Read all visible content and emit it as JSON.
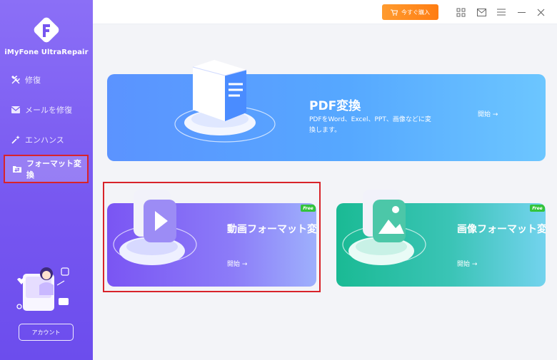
{
  "app": {
    "name": "iMyFone UltraRepair"
  },
  "sidebar": {
    "items": [
      {
        "label": "修復",
        "icon": "tools-icon"
      },
      {
        "label": "メールを修復",
        "icon": "mail-icon"
      },
      {
        "label": "エンハンス",
        "icon": "magic-wand-icon"
      },
      {
        "label": "フォーマット変換",
        "icon": "folder-convert-icon",
        "active": true
      }
    ],
    "account_label": "アカウント"
  },
  "topbar": {
    "buy_label": "今すぐ購入",
    "icons": [
      "apps-grid-icon",
      "mail-icon",
      "menu-icon",
      "minimize-icon",
      "close-icon"
    ]
  },
  "cards": {
    "pdf": {
      "title": "PDF変換",
      "desc_line1": "PDFをWord、Excel、PPT、画像などに変",
      "desc_line2": "換します。",
      "start_label": "開始 →"
    },
    "video": {
      "title": "動画フォーマット変換",
      "start_label": "開始 →",
      "badge": "Free"
    },
    "image": {
      "title": "画像フォーマット変換",
      "start_label": "開始 →",
      "badge": "Free"
    }
  },
  "colors": {
    "sidebar": "#7656f0",
    "buy": "#ff8a1f",
    "pdf_card": "#5b93ff",
    "video_card": "#7a55f3",
    "image_card": "#1aba94",
    "highlight": "#d8232a",
    "free_badge": "#34c43b"
  }
}
